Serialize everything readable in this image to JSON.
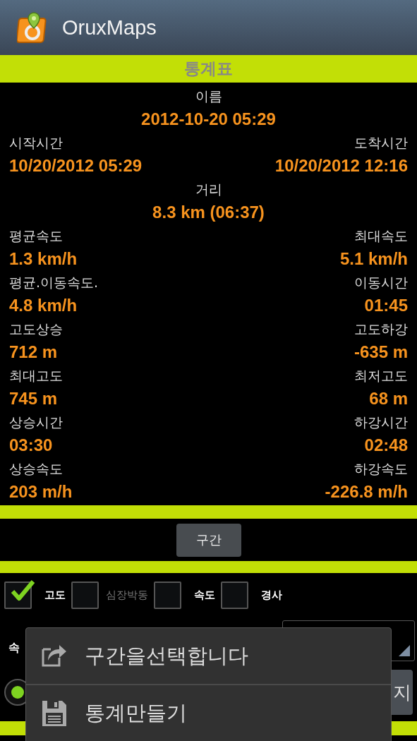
{
  "app_bar": {
    "title": "OruxMaps"
  },
  "stats": {
    "title": "통계표",
    "fields": [
      {
        "kind": "center",
        "label": "이름",
        "value": "2012-10-20 05:29"
      },
      {
        "kind": "pair",
        "left": {
          "label": "시작시간",
          "value": "10/20/2012 05:29"
        },
        "right": {
          "label": "도착시간",
          "value": "10/20/2012 12:16"
        }
      },
      {
        "kind": "center",
        "label": "거리",
        "value": "8.3 km (06:37)"
      },
      {
        "kind": "pair",
        "left": {
          "label": "평균속도",
          "value": "1.3 km/h"
        },
        "right": {
          "label": "최대속도",
          "value": "5.1 km/h"
        }
      },
      {
        "kind": "pair",
        "left": {
          "label": "평균.이동속도.",
          "value": "4.8 km/h"
        },
        "right": {
          "label": "이동시간",
          "value": "01:45"
        }
      },
      {
        "kind": "pair",
        "left": {
          "label": "고도상승",
          "value": "712 m"
        },
        "right": {
          "label": "고도하강",
          "value": "-635 m"
        }
      },
      {
        "kind": "pair",
        "left": {
          "label": "최대고도",
          "value": "745 m"
        },
        "right": {
          "label": "최저고도",
          "value": "68 m"
        }
      },
      {
        "kind": "pair",
        "left": {
          "label": "상승시간",
          "value": "03:30"
        },
        "right": {
          "label": "하강시간",
          "value": "02:48"
        }
      },
      {
        "kind": "pair",
        "left": {
          "label": "상승속도",
          "value": "203 m/h"
        },
        "right": {
          "label": "하강속도",
          "value": "-226.8 m/h"
        }
      }
    ]
  },
  "segment_button": "구간",
  "graph_options": [
    {
      "label": "고도",
      "checked": true,
      "disabled": false
    },
    {
      "label": "심장박동",
      "checked": false,
      "disabled": true
    },
    {
      "label": "속도",
      "checked": false,
      "disabled": false
    },
    {
      "label": "경사",
      "checked": false,
      "disabled": false
    }
  ],
  "speed_label": "속",
  "radio": {
    "selected": true
  },
  "partial_button": "지",
  "popup_menu": {
    "items": [
      {
        "kind": "share",
        "label": "구간을선택합니다"
      },
      {
        "kind": "save",
        "label": "통계만들기"
      }
    ]
  }
}
